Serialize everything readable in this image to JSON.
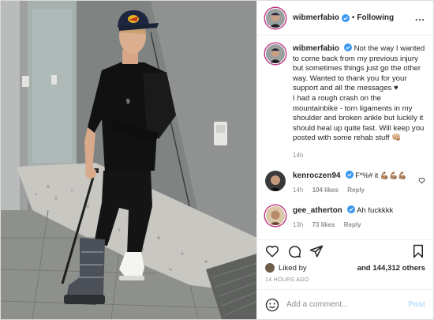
{
  "header": {
    "username": "wibmerfabio",
    "separator": "•",
    "follow_label": "Following",
    "more_label": "..."
  },
  "caption": {
    "username": "wibmerfabio",
    "text": "Not the way I wanted to come back from my previous injury but sometimes things just go the other way. Wanted to thank you for your support and all the messages ♥\nI had a rough crash on the mountainbike - torn ligaments in my shoulder and broken ankle but luckily it should heal up quite fast. Will keep you posted with some rehab stuff 👊🏼",
    "time": "14h"
  },
  "comments": [
    {
      "username": "kenroczen94",
      "text": "F*%# it 💪🏽💪🏽💪🏽",
      "time": "14h",
      "likes": "104 likes",
      "reply": "Reply"
    },
    {
      "username": "gee_atherton",
      "text": "Ah fuckkkk",
      "time": "13h",
      "likes": "73 likes",
      "reply": "Reply"
    }
  ],
  "likes": {
    "prefix": "Liked by",
    "count": "and 144,312 others"
  },
  "timestamp": "14 HOURS AGO",
  "add_comment": {
    "placeholder": "Add a comment...",
    "post_label": "Post"
  },
  "icons": {
    "verified": "verified-badge-icon",
    "heart": "heart-icon",
    "comment": "comment-icon",
    "share": "share-icon",
    "save": "bookmark-icon",
    "emoji": "emoji-icon"
  },
  "colors": {
    "verified": "#3897f0",
    "post_disabled": "#b2dffc",
    "meta_gray": "#8e8e8e"
  }
}
